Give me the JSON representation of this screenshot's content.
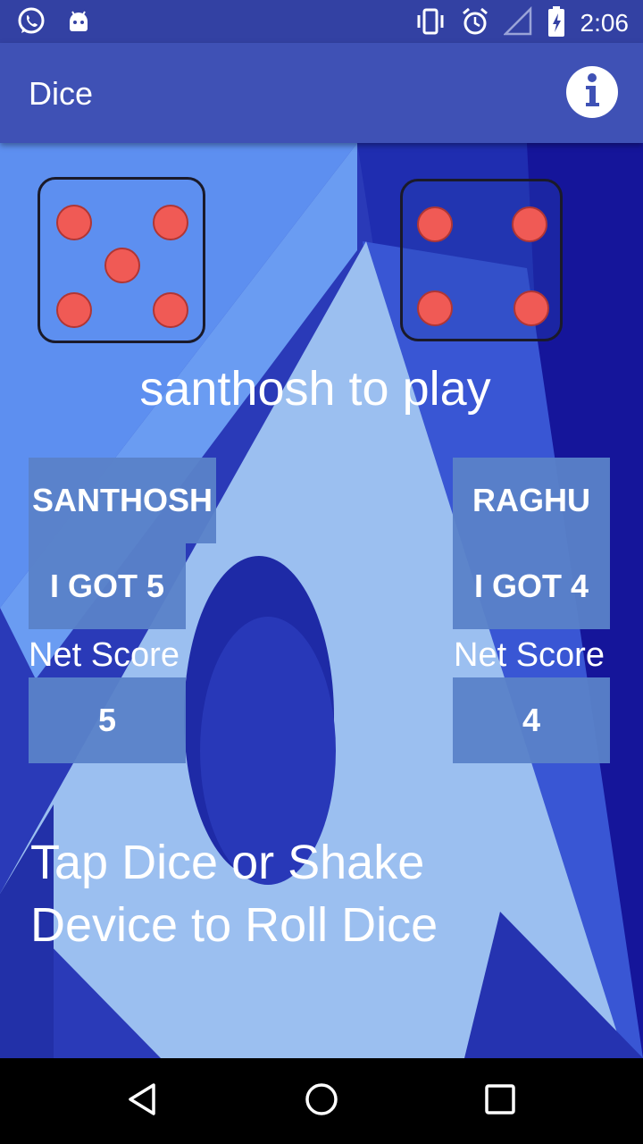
{
  "status_bar": {
    "time": "2:06",
    "left_icons": [
      "whatsapp-icon",
      "android-icon"
    ],
    "right_icons": [
      "vibrate-icon",
      "alarm-icon",
      "signal-icon",
      "battery-charging-icon"
    ]
  },
  "app_bar": {
    "title": "Dice",
    "action_icon": "info-icon"
  },
  "game": {
    "dice": [
      {
        "player": "santhosh",
        "value": 5
      },
      {
        "player": "raghu",
        "value": 4
      }
    ],
    "turn_text": "santhosh to play",
    "players": [
      {
        "name": "SANTHOSH",
        "roll_text": "I GOT 5",
        "net_label": "Net Score",
        "net_score": "5"
      },
      {
        "name": "RAGHU",
        "roll_text": "I GOT 4",
        "net_label": "Net Score",
        "net_score": "4"
      }
    ],
    "hint": "Tap Dice or Shake Device to Roll Dice"
  },
  "nav_bar": {
    "buttons": [
      "back-icon",
      "home-icon",
      "recents-icon"
    ]
  },
  "colors": {
    "status_bar": "#3341a3",
    "app_bar": "#3f51b5",
    "pip": "#f05a55",
    "tile": "#5a82c8"
  }
}
